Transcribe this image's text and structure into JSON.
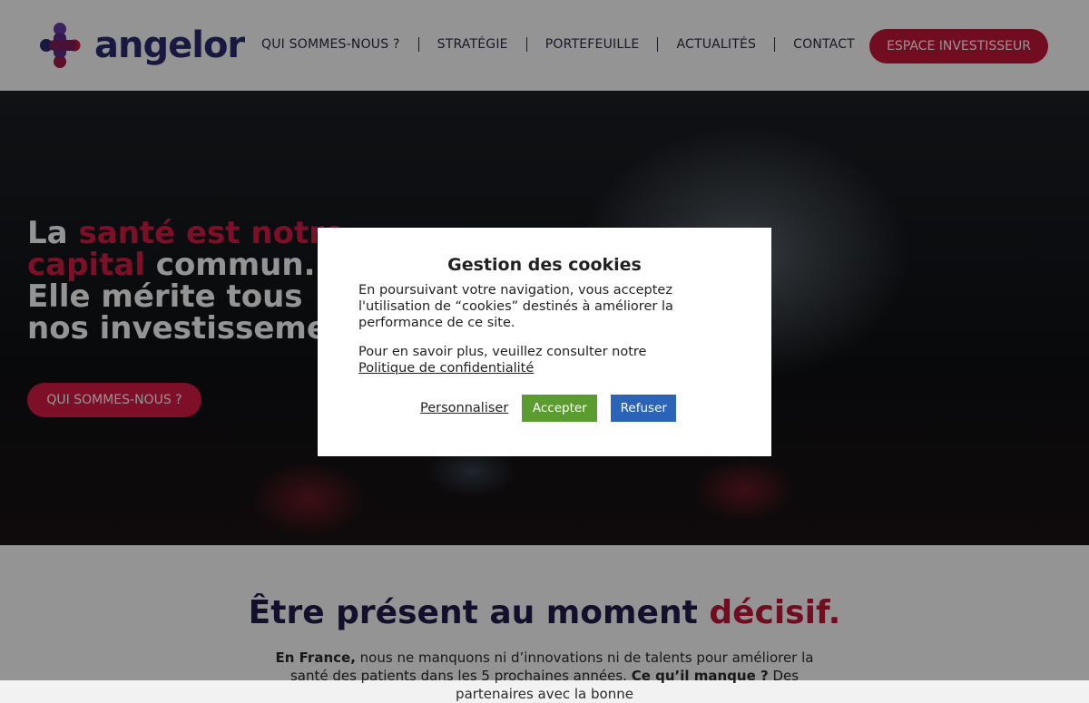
{
  "brand": {
    "name": "angelor",
    "colors": {
      "navy": "#2a2a70",
      "crimson": "#c4173a",
      "purple": "#6a3aa8",
      "accept_green": "#5b9c31",
      "refuse_blue": "#2a63b8"
    }
  },
  "nav": {
    "items": [
      {
        "label": "QUI SOMMES-NOUS ?"
      },
      {
        "label": "STRATÉGIE"
      },
      {
        "label": "PORTEFEUILLE"
      },
      {
        "label": "ACTUALITÉS"
      },
      {
        "label": "CONTACT"
      }
    ],
    "cta_label": "ESPACE INVESTISSEUR"
  },
  "hero": {
    "line1_plain": "La ",
    "line1_accent": "santé est notre",
    "line2_accent": "capital",
    "line2_plain": " commun.",
    "line3": "Elle mérite tous",
    "line4": "nos investissements.",
    "button_label": "QUI SOMMES-NOUS ?"
  },
  "section": {
    "title_plain": "Être présent au moment ",
    "title_accent": "décisif.",
    "intro_bold": "En France,",
    "intro_text": " nous ne manquons ni d’innovations ni de talents pour améliorer la santé des patients dans les 5 prochaines années. ",
    "intro_bold2": "Ce qu’il manque ?",
    "intro_text2": " Des partenaires avec la bonne"
  },
  "cookie": {
    "title": "Gestion des cookies",
    "paragraph1": "En poursuivant votre navigation, vous acceptez l'utilisation de “cookies” destinés à améliorer la performance de ce site.",
    "paragraph2": "Pour en savoir plus, veuillez consulter notre",
    "privacy_link": "Politique de confidentialité",
    "customize_label": "Personnaliser",
    "accept_label": "Accepter",
    "refuse_label": "Refuser"
  }
}
